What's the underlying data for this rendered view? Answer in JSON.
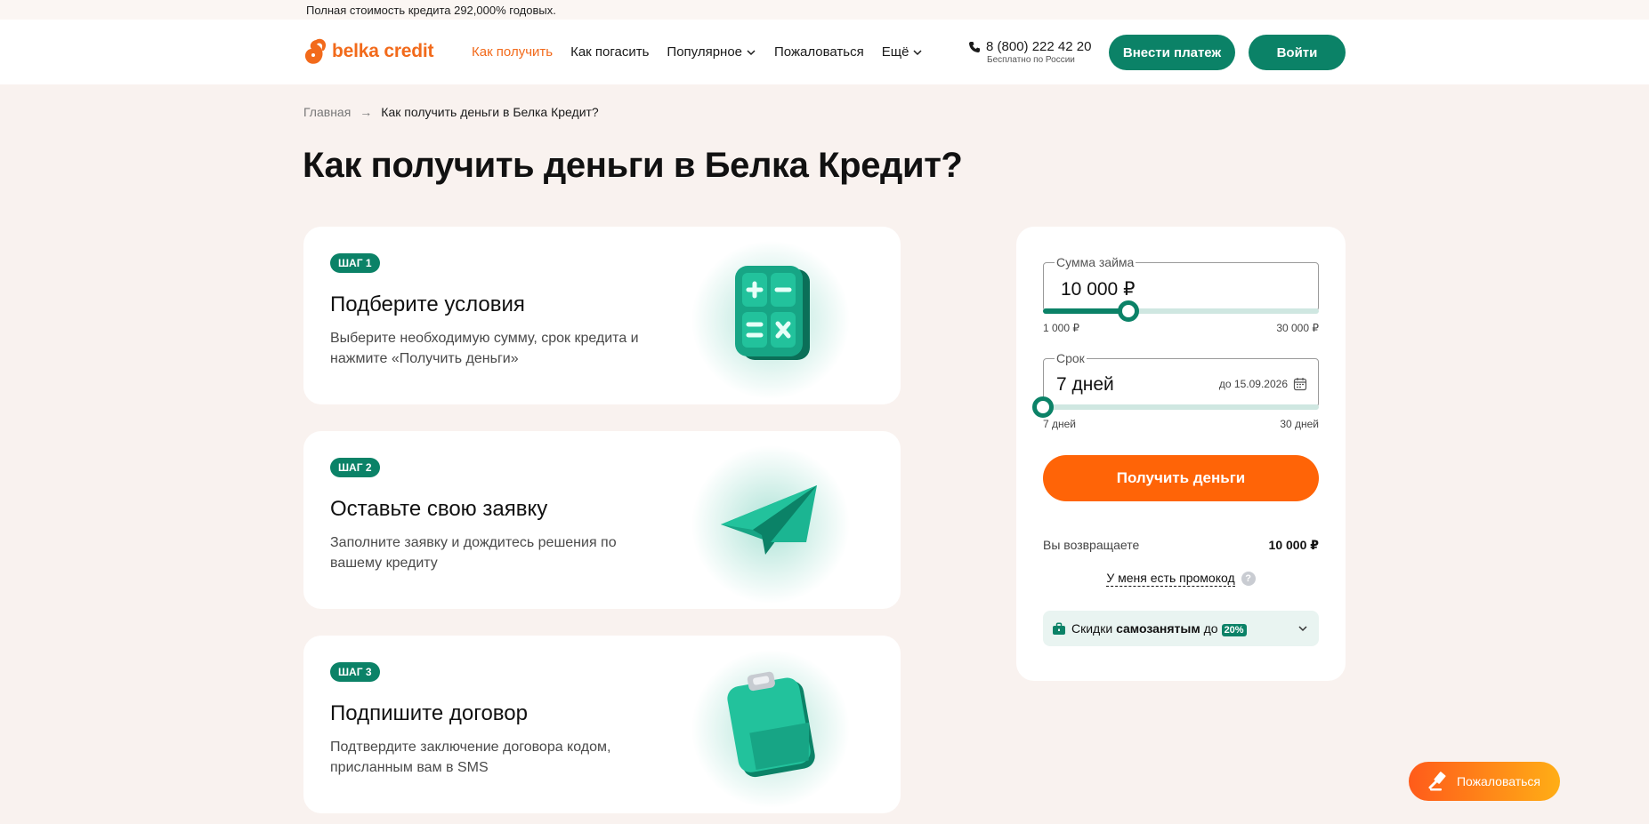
{
  "topbar": {
    "notice": "Полная стоимость кредита 292,000% годовых."
  },
  "header": {
    "logo_text": "belka credit",
    "nav": [
      {
        "label": "Как получить",
        "active": true
      },
      {
        "label": "Как погасить"
      },
      {
        "label": "Популярное",
        "dropdown": true
      },
      {
        "label": "Пожаловаться"
      },
      {
        "label": "Ещё",
        "dropdown": true
      }
    ],
    "phone": "8 (800) 222 42 20",
    "phone_note": "Бесплатно по России",
    "pay_button": "Внести платеж",
    "login_button": "Войти"
  },
  "breadcrumb": {
    "home": "Главная",
    "separator": "→",
    "current": "Как получить деньги в Белка Кредит?"
  },
  "page_title": "Как получить деньги в Белка Кредит?",
  "steps": [
    {
      "badge": "ШАГ 1",
      "title": "Подберите условия",
      "description": "Выберите необходимую сумму, срок кредита и нажмите «Получить деньги»",
      "icon": "calculator-icon"
    },
    {
      "badge": "ШАГ 2",
      "title": "Оставьте свою заявку",
      "description": "Заполните заявку и дождитесь решения по вашему кредиту",
      "icon": "paper-plane-icon"
    },
    {
      "badge": "ШАГ 3",
      "title": "Подпишите договор",
      "description": "Подтвердите заключение договора кодом, присланным вам в SMS",
      "icon": "clipboard-icon"
    }
  ],
  "calculator": {
    "amount": {
      "label": "Сумма займа",
      "value": "10 000 ₽",
      "min_label": "1 000 ₽",
      "max_label": "30 000 ₽",
      "fraction": 0.31
    },
    "term": {
      "label": "Срок",
      "value": "7 дней",
      "until": "до 15.09.2026",
      "min_label": "7 дней",
      "max_label": "30 дней",
      "fraction": 0.0
    },
    "get_money_button": "Получить деньги",
    "return_label": "Вы возвращаете",
    "return_value": "10 000 ₽",
    "promo_link": "У меня есть промокод",
    "promo_help": "?",
    "discount": {
      "prefix": "Скидки",
      "bold": "самозанятым",
      "mid": "до",
      "percent": "20%"
    }
  },
  "complain_button": "Пожаловаться",
  "colors": {
    "accent_green": "#0b8267",
    "accent_orange": "#ff6407",
    "background": "#f9f2ef"
  }
}
